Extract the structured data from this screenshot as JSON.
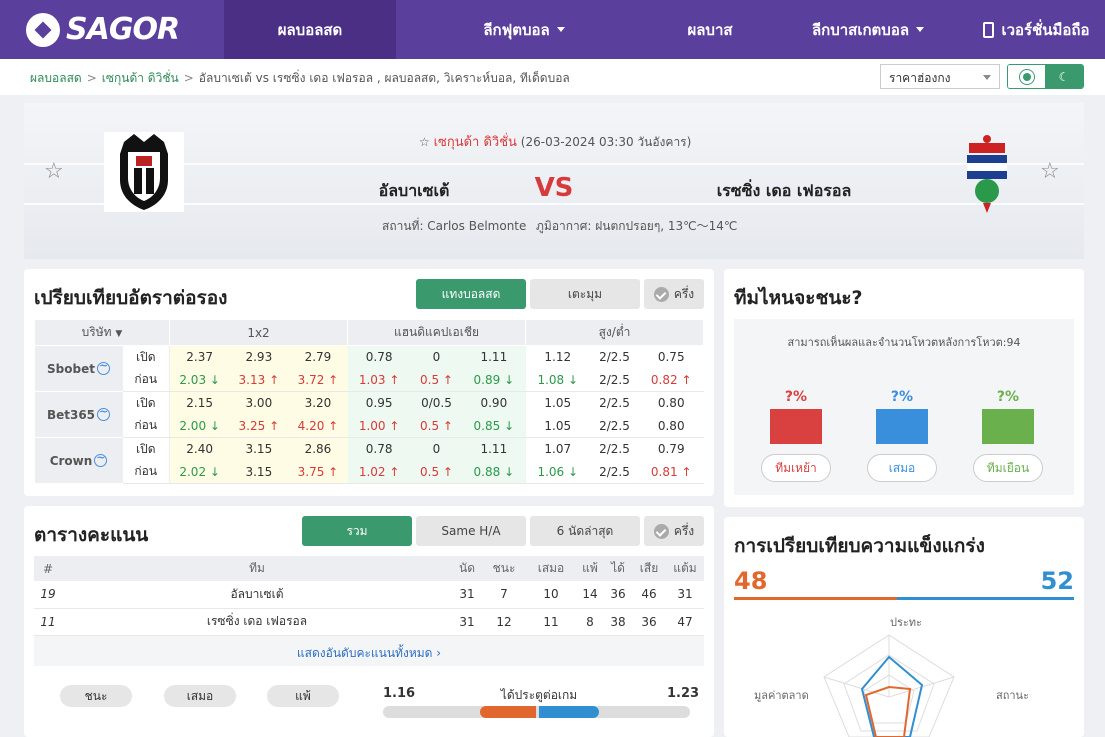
{
  "nav": {
    "logo": "SAGOR",
    "items": [
      {
        "label": "ผลบอลสด",
        "active": true,
        "dropdown": false
      },
      {
        "label": "ลีกฟุตบอล",
        "active": false,
        "dropdown": true
      },
      {
        "label": "ผลบาส",
        "active": false,
        "dropdown": false
      },
      {
        "label": "ลีกบาสเกตบอล",
        "active": false,
        "dropdown": true
      },
      {
        "label": "เวอร์ชั่นมือถือ",
        "active": false,
        "dropdown": false
      }
    ]
  },
  "breadcrumb": {
    "home": "ผลบอลสด",
    "league": "เซกุนด้า ดิวิชั่น",
    "current": "อัลบาเซเต้ vs  เรซซิ่ง เดอ เฟอรอล ,  ผลบอลสด,  วิเคราะห์บอล,  ทีเด็ดบอล"
  },
  "odds_select": "ราคาฮ่องกง",
  "theme": {
    "light_icon": "sun-icon",
    "dark_icon": "moon-icon"
  },
  "match": {
    "league": "เซกุนด้า ดิวิชั่น",
    "datetime": "(26-03-2024 03:30 วันอังคาร)",
    "home": "อัลบาเซเต้",
    "away": "เรซซิ่ง เดอ เฟอรอล",
    "vs": "VS",
    "venue": "สถานที่: Carlos Belmonte",
    "weather": "ภูมิอากาศ: ฝนตกปรอยๆ, 13℃～14℃"
  },
  "odds": {
    "title": "เปรียบเทียบอัตราต่อรอง",
    "tabs": [
      "แทงบอลสด",
      "เตะมุม",
      "ครึ่ง"
    ],
    "headers": {
      "company": "บริษัท",
      "x12": "1x2",
      "hdp": "แฮนดิแคปเอเชีย",
      "ou": "สูง/ต่ำ"
    },
    "open_label": "เปิด",
    "pre_label": "ก่อน",
    "rows": [
      {
        "company": "Sbobet",
        "open": [
          "2.37",
          "2.93",
          "2.79",
          "0.78",
          "0",
          "1.11",
          "1.12",
          "2/2.5",
          "0.75"
        ],
        "pre": [
          "2.03",
          "3.13",
          "3.72",
          "1.03",
          "0.5",
          "0.89",
          "1.08",
          "2/2.5",
          "0.82"
        ],
        "pre_dir": [
          "dn",
          "up",
          "up",
          "up",
          "up",
          "dn",
          "dn",
          "",
          "up"
        ]
      },
      {
        "company": "Bet365",
        "open": [
          "2.15",
          "3.00",
          "3.20",
          "0.95",
          "0/0.5",
          "0.90",
          "1.05",
          "2/2.5",
          "0.80"
        ],
        "pre": [
          "2.00",
          "3.25",
          "4.20",
          "1.00",
          "0.5",
          "0.85",
          "1.05",
          "2/2.5",
          "0.80"
        ],
        "pre_dir": [
          "dn",
          "up",
          "up",
          "up",
          "up",
          "dn",
          "",
          "",
          ""
        ]
      },
      {
        "company": "Crown",
        "open": [
          "2.40",
          "3.15",
          "2.86",
          "0.78",
          "0",
          "1.11",
          "1.07",
          "2/2.5",
          "0.79"
        ],
        "pre": [
          "2.02",
          "3.15",
          "3.75",
          "1.02",
          "0.5",
          "0.88",
          "1.06",
          "2/2.5",
          "0.81"
        ],
        "pre_dir": [
          "dn",
          "",
          "up",
          "up",
          "up",
          "dn",
          "dn",
          "",
          "up"
        ]
      }
    ]
  },
  "standings": {
    "title": "ตารางคะแนน",
    "tabs": [
      "รวม",
      "Same H/A",
      "6 นัดล่าสุด",
      "ครึ่ง"
    ],
    "headers": [
      "#",
      "ทีม",
      "นัด",
      "ชนะ",
      "เสมอ",
      "แพ้",
      "ได้",
      "เสีย",
      "แต้ม"
    ],
    "rows": [
      [
        "19",
        "อัลบาเซเต้",
        "31",
        "7",
        "10",
        "14",
        "36",
        "46",
        "31"
      ],
      [
        "11",
        "เรซซิ่ง เดอ เฟอรอล",
        "31",
        "12",
        "11",
        "8",
        "38",
        "36",
        "47"
      ]
    ],
    "show_all": "แสดงอันดับคะแนนทั้งหมด",
    "pills": [
      "ชนะ",
      "เสมอ",
      "แพ้"
    ],
    "goals": {
      "label": "ได้ประตูต่อเกม",
      "home": "1.16",
      "away": "1.23"
    }
  },
  "vote": {
    "title": "ทีมไหนจะชนะ?",
    "desc": "สามารถเห็นผลและจำนวนโหวตหลังการโหวต:94",
    "options": [
      {
        "pct": "?%",
        "label": "ทีมเหย้า",
        "color": "#d94040"
      },
      {
        "pct": "?%",
        "label": "เสมอ",
        "color": "#3a8fdc"
      },
      {
        "pct": "?%",
        "label": "ทีมเยือน",
        "color": "#6ab04c"
      }
    ]
  },
  "strength": {
    "title": "การเปรียบเทียบความแข็งแกร่ง",
    "home": "48",
    "away": "52",
    "home_color": "#e2672e",
    "away_color": "#2f8fd0",
    "axes": [
      "ประทะ",
      "สถานะ",
      "มูลค่าตลาด"
    ]
  }
}
